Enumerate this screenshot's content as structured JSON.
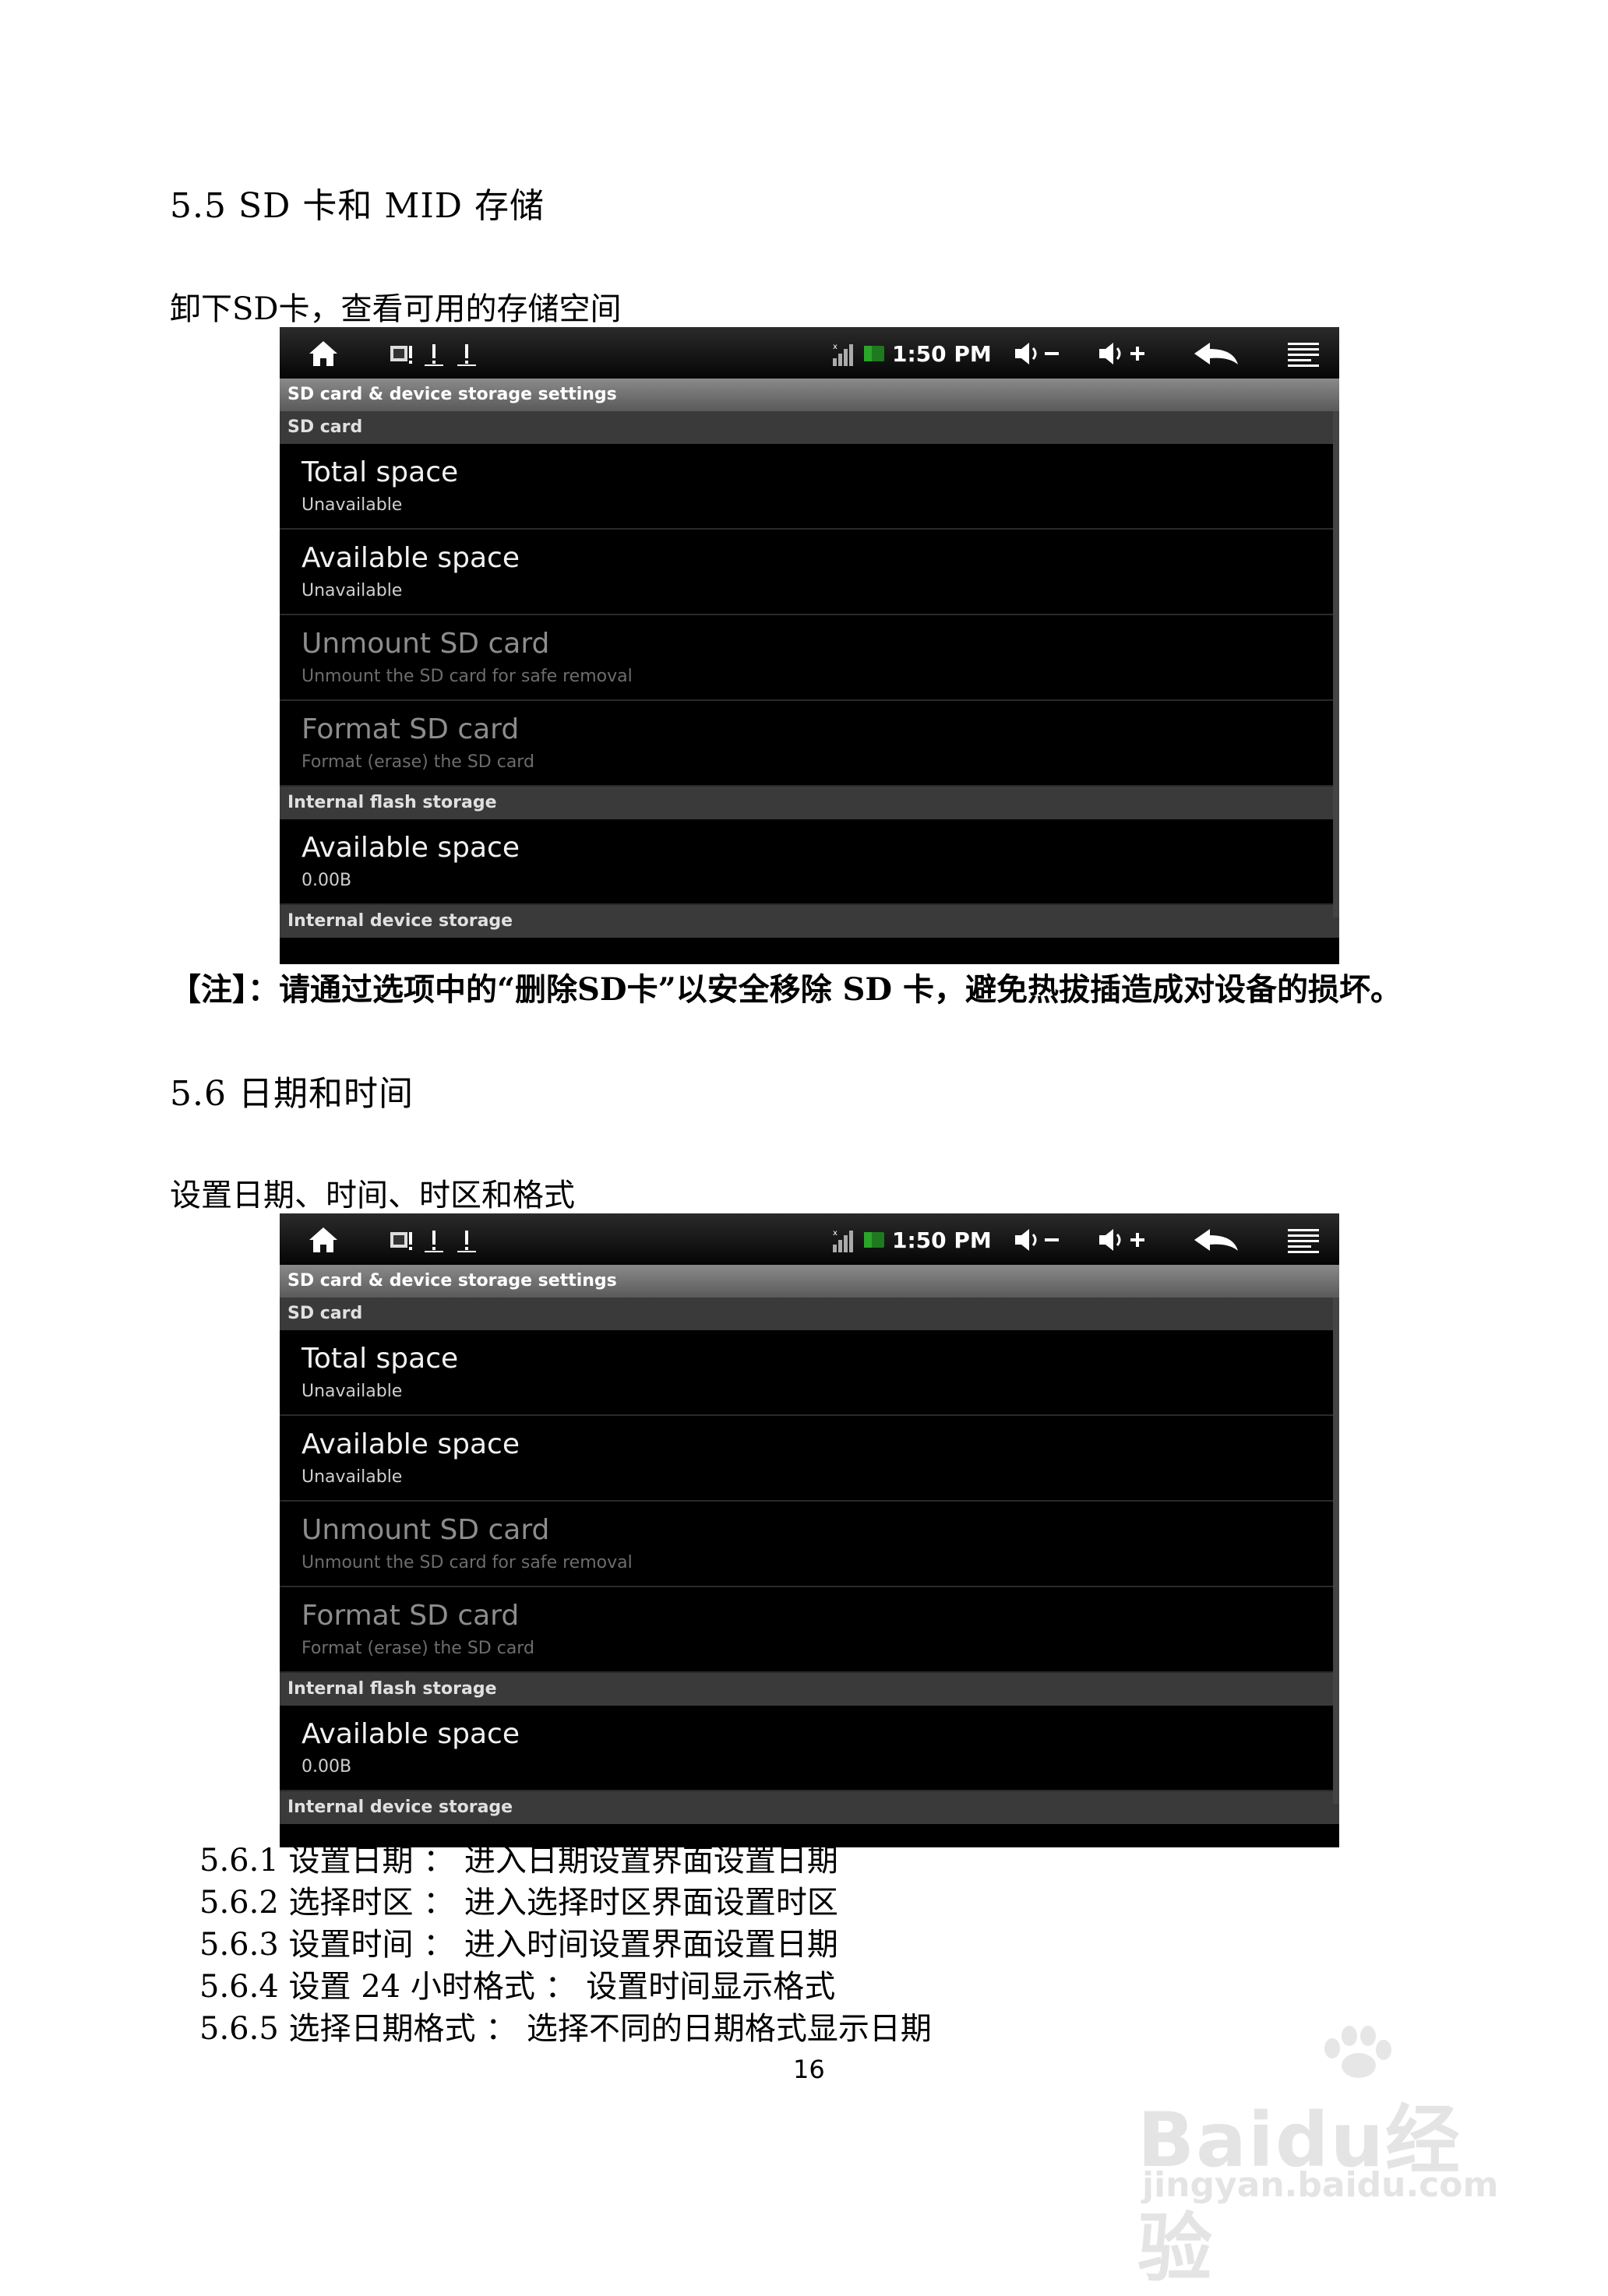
{
  "section_55": {
    "heading": "5.5   SD 卡和 MID 存储",
    "intro": "卸下SD卡，查看可用的存储空间"
  },
  "note": "【注】：请通过选项中的“删除SD卡”以安全移除 SD 卡，避免热拔插造成对设备的损坏。",
  "section_56": {
    "heading": "5.6 日期和时间",
    "intro": "设置日期、时间、时区和格式"
  },
  "screenshot": {
    "status": {
      "time": "1:50 PM"
    },
    "title": "SD card & device storage settings",
    "sd_header": "SD card",
    "rows": [
      {
        "title": "Total space",
        "summary": "Unavailable"
      },
      {
        "title": "Available space",
        "summary": "Unavailable"
      },
      {
        "title": "Unmount SD card",
        "summary": "Unmount the SD card for safe removal"
      },
      {
        "title": "Format SD card",
        "summary": "Format (erase) the SD card"
      }
    ],
    "flash_header": "Internal flash storage",
    "flash_row": {
      "title": "Available space",
      "summary": "0.00B"
    },
    "device_header": "Internal device storage"
  },
  "items": [
    "5.6.1 设置日期 ：  进入日期设置界面设置日期",
    "5.6.2 选择时区 ：  进入选择时区界面设置时区",
    "5.6.3 设置时间 ：  进入时间设置界面设置日期",
    "5.6.4 设置 24 小时格式 ：  设置时间显示格式",
    "5.6.5 选择日期格式 ：  选择不同的日期格式显示日期"
  ],
  "page_number": "16",
  "watermark": {
    "brand": "Baidu经验",
    "url": "jingyan.baidu.com"
  }
}
